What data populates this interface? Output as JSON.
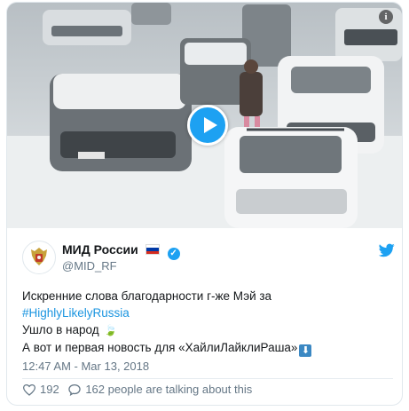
{
  "tweet": {
    "media": {
      "type": "video",
      "play_icon": "play-icon",
      "info_icon": "info-icon",
      "info_glyph": "i"
    },
    "author": {
      "name": "МИД России",
      "handle": "@MID_RF",
      "verified": true,
      "flag_icon": "russia-flag-icon",
      "avatar_icon": "coat-of-arms-icon"
    },
    "platform_icon": "twitter-bird-icon",
    "text_lines": {
      "line1": "Искренние слова благодарности г-же Мэй за",
      "hashtag": "#HighlyLikelyRussia",
      "line3": "Ушло в народ",
      "line4": "А вот и первая новость для «ХайлиЛайклиРаша»"
    },
    "timestamp": "12:47 AM - Mar 13, 2018",
    "likes": "192",
    "talking": "162 people are talking about this",
    "colors": {
      "accent": "#1da1f2",
      "link": "#1b95e0",
      "muted": "#657786"
    }
  }
}
